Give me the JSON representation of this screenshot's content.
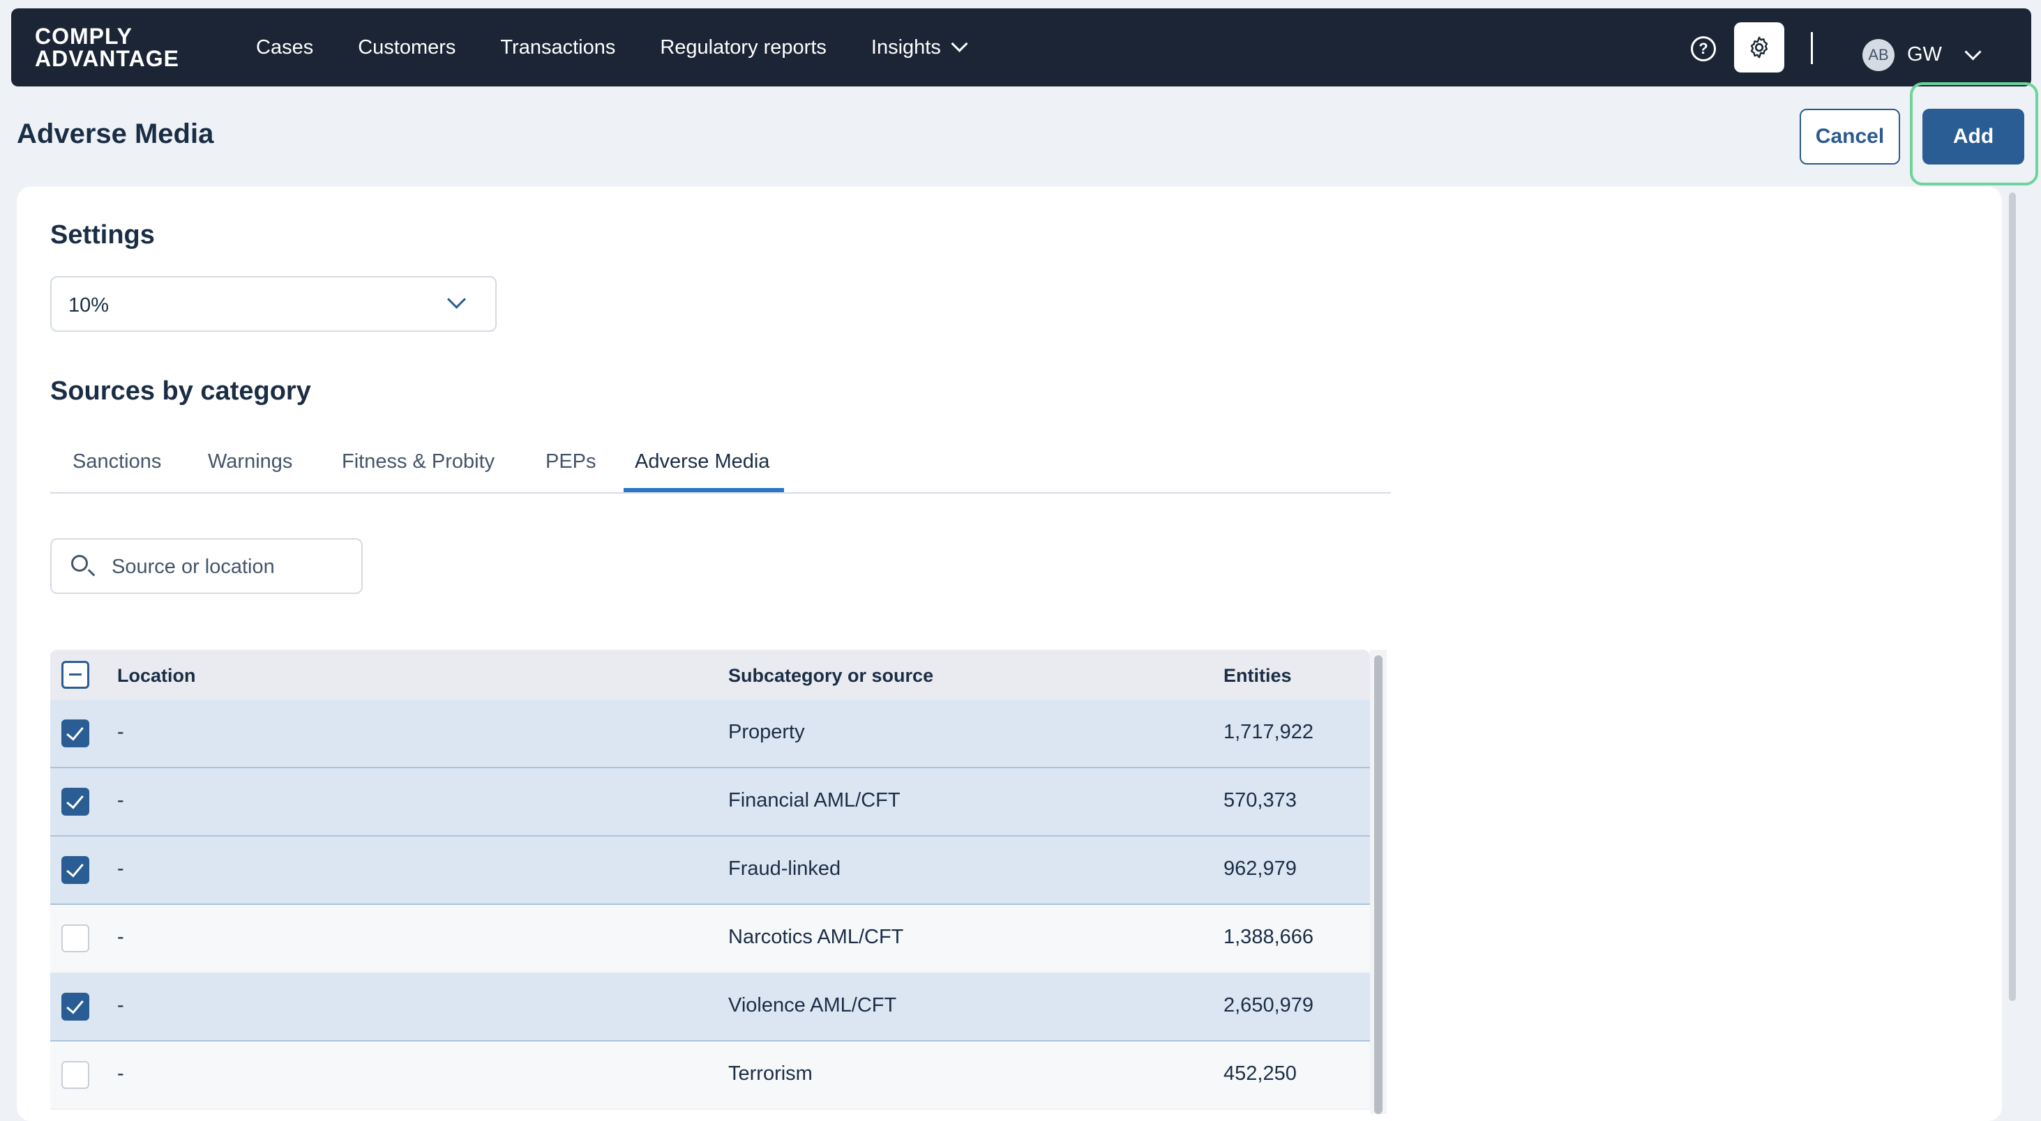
{
  "nav": {
    "logo_line1": "COMPLY",
    "logo_line2": "ADVANTAGE",
    "links": [
      {
        "label": "Cases"
      },
      {
        "label": "Customers"
      },
      {
        "label": "Transactions"
      },
      {
        "label": "Regulatory reports"
      },
      {
        "label": "Insights"
      }
    ],
    "help_icon": "help-circle-icon",
    "settings_icon": "gear-icon",
    "avatar_text": "AB",
    "user_initials": "GW"
  },
  "header": {
    "title": "Adverse Media",
    "cancel_label": "Cancel",
    "add_label": "Add"
  },
  "settings": {
    "title": "Settings",
    "threshold_value": "10%"
  },
  "sources": {
    "title": "Sources by category",
    "tabs": [
      {
        "label": "Sanctions"
      },
      {
        "label": "Warnings"
      },
      {
        "label": "Fitness & Probity"
      },
      {
        "label": "PEPs"
      },
      {
        "label": "Adverse Media"
      }
    ],
    "active_tab": "Adverse Media",
    "search_placeholder": "Source or location"
  },
  "table": {
    "headers": {
      "location": "Location",
      "subcategory": "Subcategory or source",
      "entities": "Entities"
    },
    "rows": [
      {
        "checked": true,
        "location": "-",
        "subcategory": "Property",
        "entities": "1,717,922"
      },
      {
        "checked": true,
        "location": "-",
        "subcategory": "Financial AML/CFT",
        "entities": "570,373"
      },
      {
        "checked": true,
        "location": "-",
        "subcategory": "Fraud-linked",
        "entities": "962,979"
      },
      {
        "checked": false,
        "location": "-",
        "subcategory": "Narcotics AML/CFT",
        "entities": "1,388,666"
      },
      {
        "checked": true,
        "location": "-",
        "subcategory": "Violence AML/CFT",
        "entities": "2,650,979"
      },
      {
        "checked": false,
        "location": "-",
        "subcategory": "Terrorism",
        "entities": "452,250"
      }
    ]
  },
  "colors": {
    "nav_bg": "#1b2535",
    "primary": "#2a5d94",
    "highlight": "#6fd39b",
    "checked_row": "#dbe6f2"
  }
}
